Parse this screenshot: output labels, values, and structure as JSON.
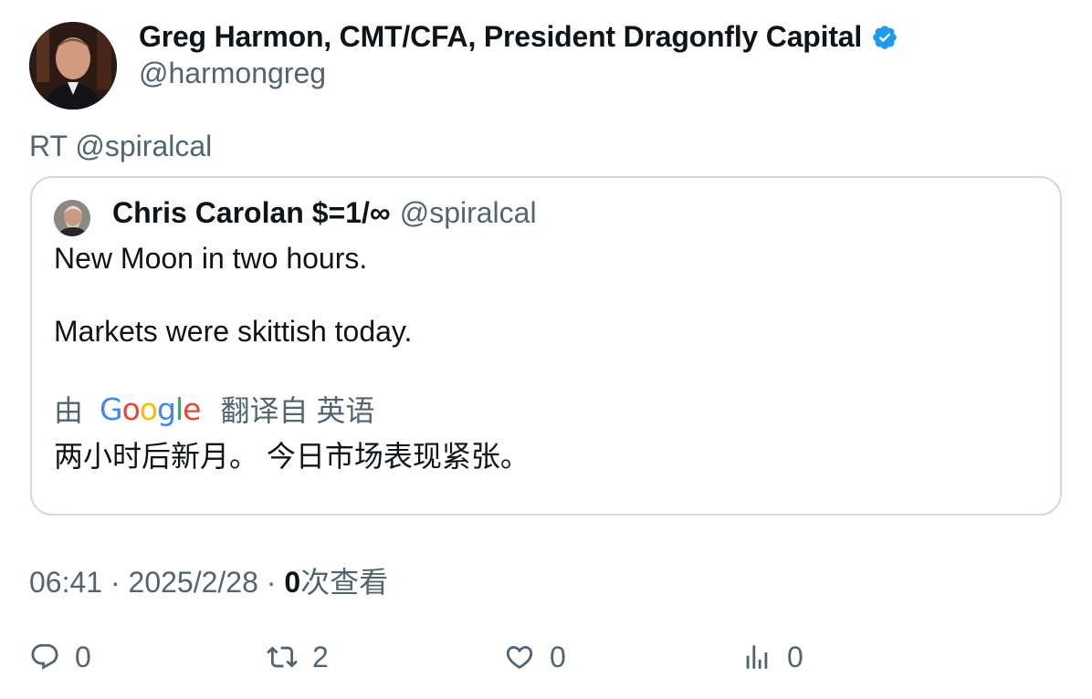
{
  "author": {
    "name": "Greg Harmon, CMT/CFA, President Dragonfly Capital",
    "handle": "@harmongreg",
    "verified": true
  },
  "retweet_prefix": "RT @spiralcal",
  "quoted_tweet": {
    "name": "Chris Carolan $=1/∞",
    "handle": "@spiralcal",
    "line1": "New Moon in two hours.",
    "line2": "Markets were skittish today.",
    "translation": {
      "prefix": "由",
      "provider": "Google",
      "suffix": "翻译自 英语",
      "text": "两小时后新月。 今日市场表现紧张。"
    }
  },
  "meta": {
    "time": "06:41",
    "separator": "·",
    "date": "2025/2/28",
    "views_count": "0",
    "views_label": "次查看"
  },
  "actions": {
    "replies": "0",
    "retweets": "2",
    "likes": "0",
    "views": "0"
  },
  "colors": {
    "text_primary": "#0f1419",
    "text_secondary": "#536471",
    "border": "#cfd9de",
    "verified": "#1d9bf0"
  },
  "icons": [
    "verified-badge-icon",
    "reply-icon",
    "retweet-icon",
    "like-icon",
    "views-icon"
  ]
}
